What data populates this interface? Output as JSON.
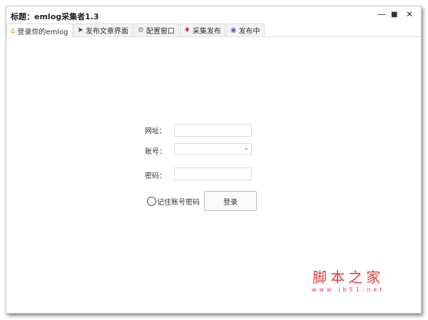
{
  "window": {
    "title": "标题：emlog采集者1.3",
    "minimize": "—",
    "maximize": "■",
    "close": "✕"
  },
  "tabs": [
    {
      "label": "登录你的emlog",
      "icon": "home-icon"
    },
    {
      "label": "发布文章界面",
      "icon": "send-icon"
    },
    {
      "label": "配置窗口",
      "icon": "gear-icon"
    },
    {
      "label": "采集发布",
      "icon": "gem-icon"
    },
    {
      "label": "发布中",
      "icon": "circle-icon"
    }
  ],
  "form": {
    "url_label": "网址：",
    "url_value": "",
    "account_label": "账号：",
    "account_value": "",
    "password_label": "密码：",
    "password_value": "",
    "remember_label": "记住账号密码",
    "login_button": "登录"
  },
  "watermark": {
    "title": "脚本之家",
    "url": "www.jb51.net"
  }
}
